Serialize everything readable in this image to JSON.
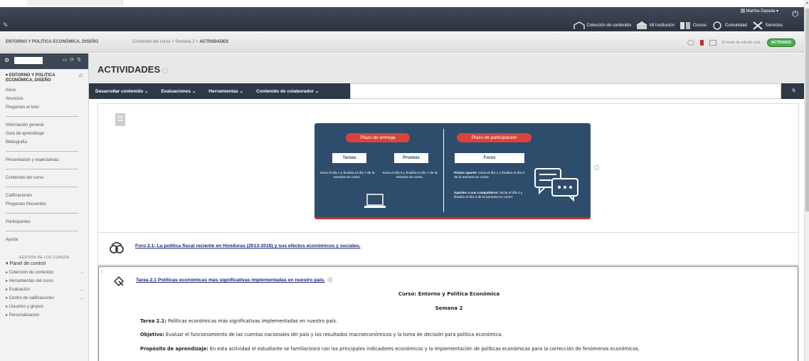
{
  "topbar": {
    "user_name": "Martha Zepeda",
    "nav": [
      {
        "label": "Colección de contenido",
        "icon": "content-collection-icon"
      },
      {
        "label": "Mi Institución",
        "icon": "institution-icon"
      },
      {
        "label": "Cursos",
        "icon": "courses-icon"
      },
      {
        "label": "Comunidad",
        "icon": "community-icon"
      },
      {
        "label": "Servicios",
        "icon": "services-icon"
      }
    ]
  },
  "breadcrumb": {
    "course": "ENTORNO Y POLÍTICA ECONÓMICA, DISEÑO",
    "path": "Contenido del curso > Semana 2 > ",
    "current": "ACTIVIDADES"
  },
  "edit_mode": {
    "label": "El modo de edición está:",
    "state": "ACTIVADO"
  },
  "sidebar": {
    "course_title": "ENTORNO Y POLITICA ECONÓMICA, DISEÑO",
    "group1": [
      "Inicio",
      "Anuncios",
      "Preguntas al tutor"
    ],
    "group2": [
      "Información general",
      "Guía de aprendizaje",
      "Bibliografía"
    ],
    "single": [
      "Presentación y expectativas",
      "Contenido del curso"
    ],
    "group3": [
      "Calificaciones",
      "Preguntas frecuentes"
    ],
    "participantes": "Participantes",
    "ayuda": "Ayuda",
    "management_header": "GESTIÓN DE LOS CURSOS",
    "panel_label": "Panel de control",
    "panel_items": [
      "Colección de contenido",
      "Herramientas del curso",
      "Evaluación",
      "Centro de calificaciones",
      "Usuarios y grupos",
      "Personalización"
    ]
  },
  "page": {
    "title": "ACTIVIDADES"
  },
  "actionbar": {
    "menus": [
      "Desarrollar contenido",
      "Evaluaciones",
      "Herramientas",
      "Contenido de colaborador"
    ]
  },
  "infographic": {
    "left_pill": "Plazo de entrega",
    "right_pill": "Plazo de participación",
    "tareas": "Tareas",
    "pruebas": "Pruebas",
    "foros": "Foros",
    "tareas_text": "Inicia el día 1 y finaliza el día 7 de la semana en curso.",
    "pruebas_text": "Inicia el día 6 y finaliza el día 7 de la semana en curso.",
    "primer_aporte_label": "Primer aporte:",
    "primer_aporte_text": " inicia el día 1 y finaliza el día 3 de la semana en curso.",
    "aportes_label": "Aportes a sus compañeros:",
    "aportes_text": " inicia el día 4 y finaliza el día 3 de la semana en curso."
  },
  "items": {
    "foro_link": "Foro 2.1: La política fiscal reciente en Honduras (2013-2016) y sus efectos económicos y sociales.",
    "tarea_link": "Tarea 2.1 Políticas económicas más significativas implementadas en nuestro país.",
    "curso": "Curso: Entorno y Política Económica",
    "semana": "Semana 2",
    "tarea_label": "Tarea 2.1:",
    "tarea_text": " Políticas económicas más significativas implementadas en nuestro país.",
    "objetivo_label": "Objetivo:",
    "objetivo_text": " Evaluar el funcionamiento de las cuentas nacionales del país y los resultados macroeconómicos y la toma de decisión para política económica.",
    "proposito_label": "Propósito de aprendizaje:",
    "proposito_text": " En esta actividad el estudiante se familiarizará con los principales indicadores económicos y la implementación de políticas económicas para la corrección de fenómenos económicos."
  }
}
